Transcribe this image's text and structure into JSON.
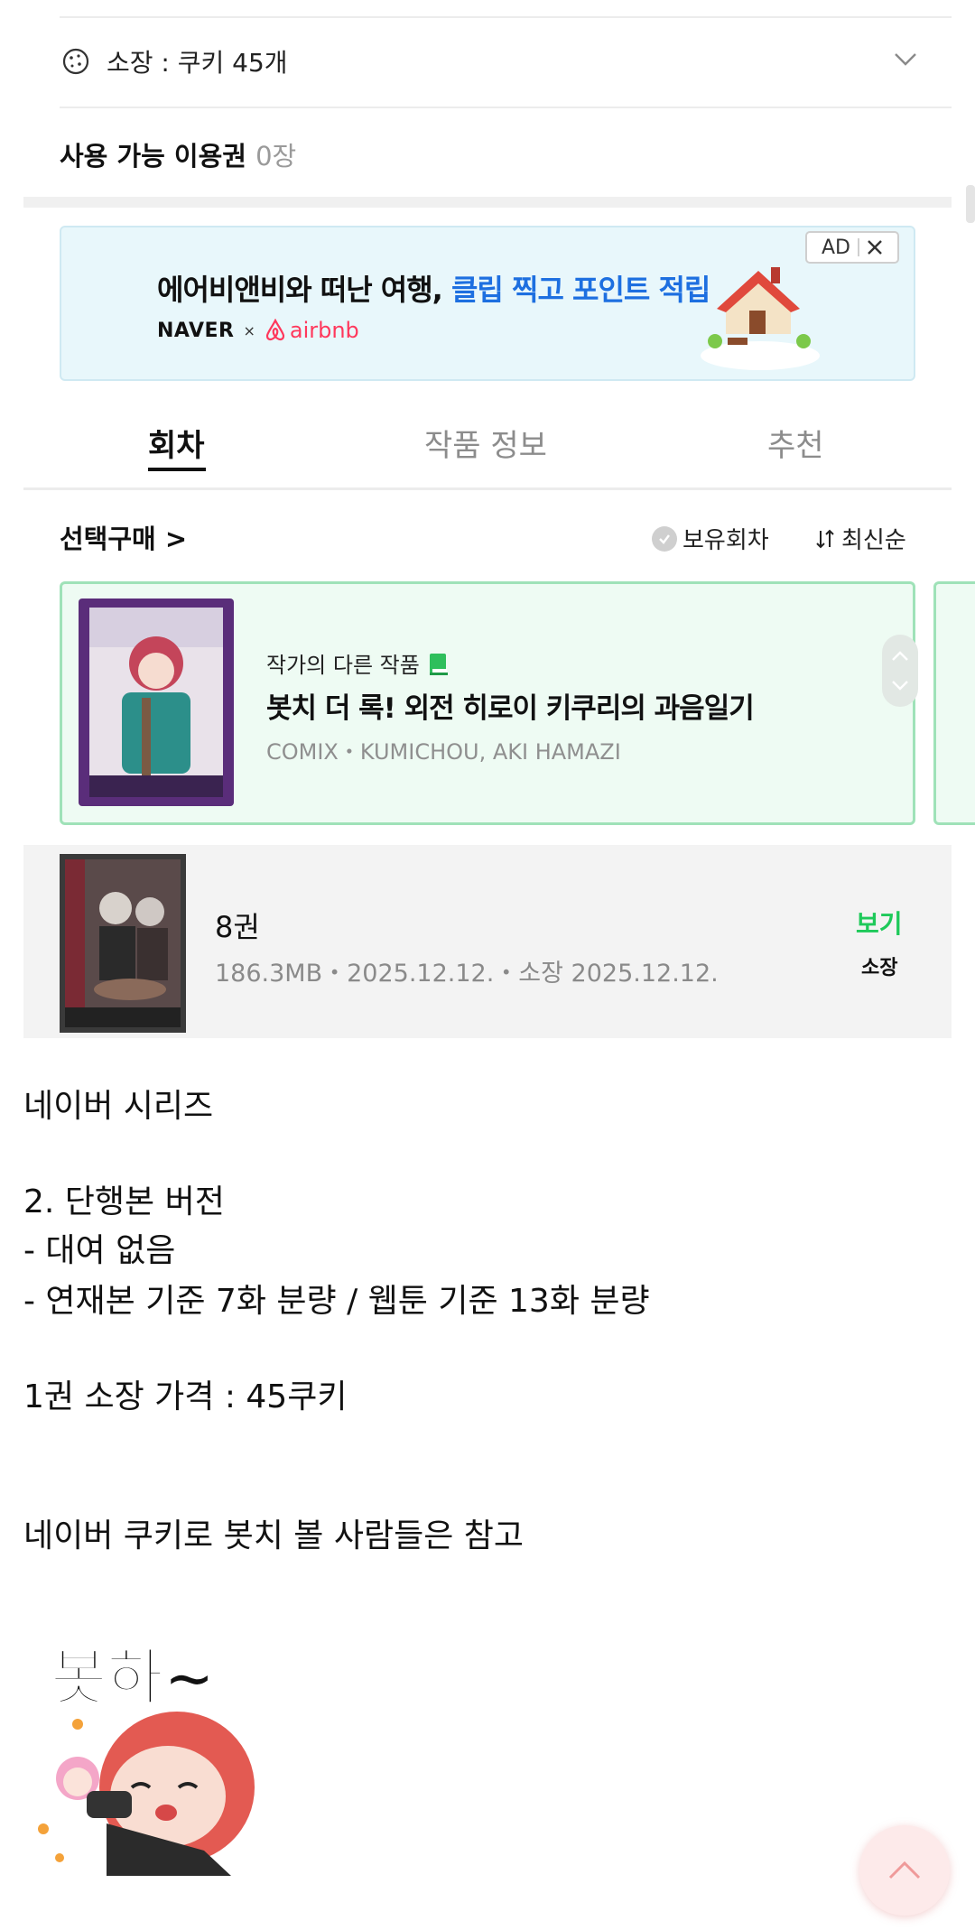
{
  "owned": {
    "label": "소장 : 쿠키 45개",
    "icon": "cookie-icon"
  },
  "ticket": {
    "label": "사용 가능 이용권",
    "count": "0장"
  },
  "ad": {
    "headline_main": "에어비앤비와 떠난 여행, ",
    "headline_highlight": "클립 찍고 포인트 적립",
    "brand_naver": "NAVER",
    "brand_x": "×",
    "brand_airbnb": "airbnb",
    "badge": "AD",
    "colors": {
      "highlight": "#1d6fe0",
      "airbnb": "#ff385c"
    }
  },
  "tabs": [
    {
      "label": "회차",
      "active": true
    },
    {
      "label": "작품 정보",
      "active": false
    },
    {
      "label": "추천",
      "active": false
    }
  ],
  "purchase": {
    "select_label": "선택구매 >",
    "owned_filter": "보유회차",
    "sort": "최신순"
  },
  "promo": {
    "subtitle": "작가의 다른 작품",
    "title": "봇치 더 록! 외전 히로이 키쿠리의 과음일기",
    "meta": "COMIX・KUMICHOU, AKI HAMAZI",
    "icon": "book-icon"
  },
  "volume": {
    "title": "8권",
    "meta": "186.3MB・2025.12.12.・소장 2025.12.12.",
    "view_label": "보기",
    "owned_label": "소장",
    "accent": "#1ec95a"
  },
  "post": {
    "lines": [
      "네이버 시리즈",
      "2. 단행본 버전",
      "- 대여 없음",
      "- 연재본 기준 7화 분량 / 웹툰 기준 13화 분량",
      "1권 소장 가격 : 45쿠키",
      "네이버 쿠키로 봇치 볼 사람들은 참고"
    ],
    "sticker_text": "봇하~"
  }
}
